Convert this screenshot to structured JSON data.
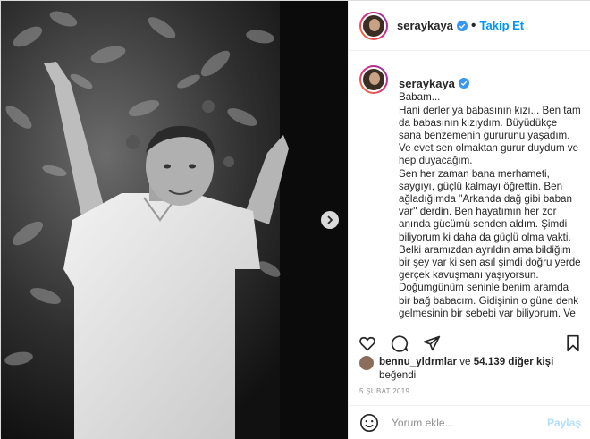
{
  "post": {
    "username": "seraykaya",
    "separator": "•",
    "follow_label": "Takip Et",
    "caption_lines": [
      "Babam...",
      "Hani derler ya babasının kızı... Ben tam da babasının kızıydım. Büyüdükçe sana benzemenin gururunu yaşadım. Ve evet sen olmaktan gurur duydum ve hep duyacağım.",
      "Sen her zaman bana merhameti, saygıyı, güçlü kalmayı öğrettin. Ben ağladığımda ''Arkanda dağ gibi baban var'' derdin. Ben hayatımın her zor anında gücümü senden aldım. Şimdi biliyorum ki daha da güçlü olma vakti. Belki aramızdan ayrıldın ama bildiğim bir şey var ki sen asıl şimdi doğru yerde gerçek kavuşmanı yaşıyorsun. Doğumgünüm seninle benim aramda bir bağ babacım. Gidişinin o güne denk gelmesinin bir sebebi var biliyorum. Ve kavuşacağımız günü"
    ],
    "likes": {
      "liker": "bennu_yldrmlar",
      "connector": "ve",
      "count_text": "54.139 diğer kişi",
      "suffix": "beğendi"
    },
    "date": "5 ŞUBAT 2019",
    "comment": {
      "placeholder": "Yorum ekle...",
      "share_label": "Paylaş"
    }
  },
  "icons": {
    "verified": "verified-badge-icon",
    "like": "heart-icon",
    "comment": "comment-bubble-icon",
    "share": "paper-plane-icon",
    "save": "bookmark-icon",
    "next": "chevron-right-icon",
    "emoji": "smiley-icon"
  },
  "colors": {
    "accent": "#0095f6",
    "verified": "#3897f0",
    "muted": "#8e8e8e",
    "share_disabled": "#b2dffc"
  }
}
